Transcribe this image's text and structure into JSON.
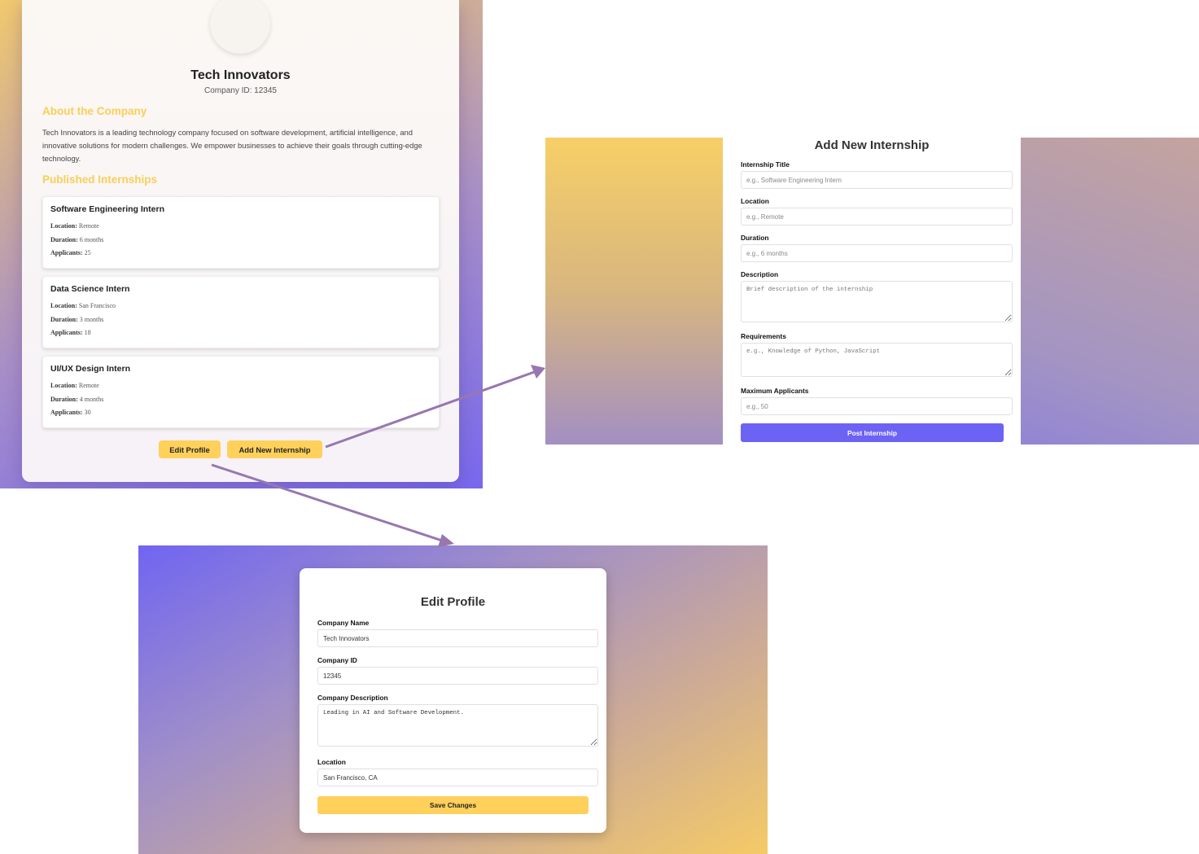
{
  "profile": {
    "company_name": "Tech Innovators",
    "company_id_text": "Company ID: 12345",
    "about_heading": "About the Company",
    "about_text": "Tech Innovators is a leading technology company focused on software development, artificial intelligence, and innovative solutions for modern challenges. We empower businesses to achieve their goals through cutting-edge technology.",
    "published_heading": "Published Internships",
    "labels": {
      "location": "Location:",
      "duration": "Duration:",
      "applicants": "Applicants:"
    },
    "internships": [
      {
        "title": "Software Engineering Intern",
        "location": "Remote",
        "duration": "6 months",
        "applicants": "25"
      },
      {
        "title": "Data Science Intern",
        "location": "San Francisco",
        "duration": "3 months",
        "applicants": "18"
      },
      {
        "title": "UI/UX Design Intern",
        "location": "Remote",
        "duration": "4 months",
        "applicants": "30"
      }
    ],
    "edit_profile_label": "Edit Profile",
    "add_internship_label": "Add New Internship"
  },
  "add_internship": {
    "title": "Add New Internship",
    "fields": {
      "title_label": "Internship Title",
      "title_placeholder": "e.g., Software Engineering Intern",
      "location_label": "Location",
      "location_placeholder": "e.g., Remote",
      "duration_label": "Duration",
      "duration_placeholder": "e.g., 6 months",
      "description_label": "Description",
      "description_placeholder": "Brief description of the internship",
      "requirements_label": "Requirements",
      "requirements_placeholder": "e.g., Knowledge of Python, JavaScript",
      "max_applicants_label": "Maximum Applicants",
      "max_applicants_placeholder": "e.g., 50"
    },
    "submit_label": "Post Internship"
  },
  "edit_profile": {
    "title": "Edit Profile",
    "fields": {
      "company_name_label": "Company Name",
      "company_name_value": "Tech Innovators",
      "company_id_label": "Company ID",
      "company_id_value": "12345",
      "description_label": "Company Description",
      "description_value": "Leading in AI and Software Development.",
      "location_label": "Location",
      "location_value": "San Francisco, CA"
    },
    "submit_label": "Save Changes"
  },
  "colors": {
    "accent_yellow": "#ffd15b",
    "accent_purple": "#6c63f5",
    "arrow": "#9777b0"
  }
}
